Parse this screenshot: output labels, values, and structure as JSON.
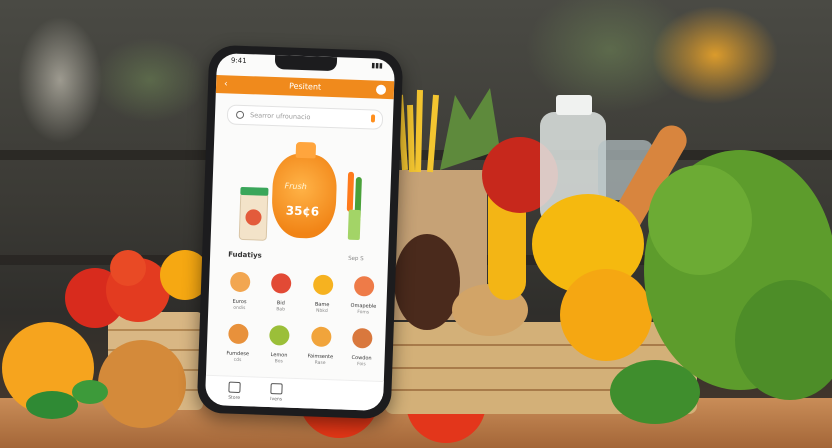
{
  "phone": {
    "status_time": "9:41",
    "app_title": "Pesitent",
    "search_placeholder": "Searror ufrounacio",
    "hero": {
      "label": "Frush",
      "price": "35¢6"
    },
    "section_title": "Fudatiys",
    "see_all": "Sep S",
    "grid_row1": [
      {
        "label": "Euros",
        "sub": "ondis",
        "color": "#f2a650"
      },
      {
        "label": "Bid",
        "sub": "Bab",
        "color": "#e24a35"
      },
      {
        "label": "Bame",
        "sub": "Nbkd",
        "color": "#f6b220"
      },
      {
        "label": "Omapeble",
        "sub": "Foms",
        "color": "#ee7b48"
      }
    ],
    "grid_row2": [
      {
        "label": "Fumdese",
        "sub": "cds",
        "color": "#e8913b"
      },
      {
        "label": "Lemon",
        "sub": "Bos",
        "color": "#9bbf39"
      },
      {
        "label": "Faimsente",
        "sub": "Rase",
        "color": "#f1a43b"
      },
      {
        "label": "Cowdon",
        "sub": "Fois",
        "color": "#d9783d"
      }
    ],
    "tabs": [
      {
        "label": "Store",
        "icon": "home-icon"
      },
      {
        "label": "Ivens",
        "icon": "cart-icon"
      }
    ],
    "colors": {
      "accent": "#f08a1c"
    }
  }
}
